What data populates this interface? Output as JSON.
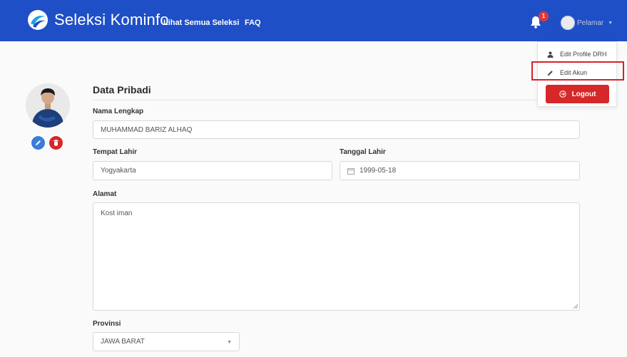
{
  "navbar": {
    "brand": "Seleksi Kominfo",
    "links": [
      "Lihat Semua Seleksi",
      "FAQ"
    ],
    "notification_count": "1",
    "user_name": "Pelamar",
    "caret": "▼"
  },
  "dropdown": {
    "items": [
      "Edit Profile DRH",
      "Edit Akun"
    ],
    "logout": "Logout",
    "highlight_color": "#d9212a"
  },
  "form": {
    "section_title": "Data Pribadi",
    "nama_label": "Nama Lengkap",
    "nama_value": "MUHAMMAD BARIZ ALHAQ",
    "tempat_label": "Tempat Lahir",
    "tempat_value": "Yogyakarta",
    "tanggal_label": "Tanggal Lahir",
    "tanggal_value": "1999-05-18",
    "alamat_label": "Alamat",
    "alamat_value": "Kost iman",
    "provinsi_label": "Provinsi",
    "provinsi_value": "JAWA BARAT",
    "select_caret": "▼"
  },
  "colors": {
    "navbar": "#1f4fc6",
    "danger": "#d62828",
    "edit": "#3b7dd8"
  },
  "icons": [
    "kominfo-logo",
    "bell-icon",
    "user-icon",
    "pencil-icon",
    "logout-icon",
    "trash-icon",
    "calendar-icon"
  ]
}
